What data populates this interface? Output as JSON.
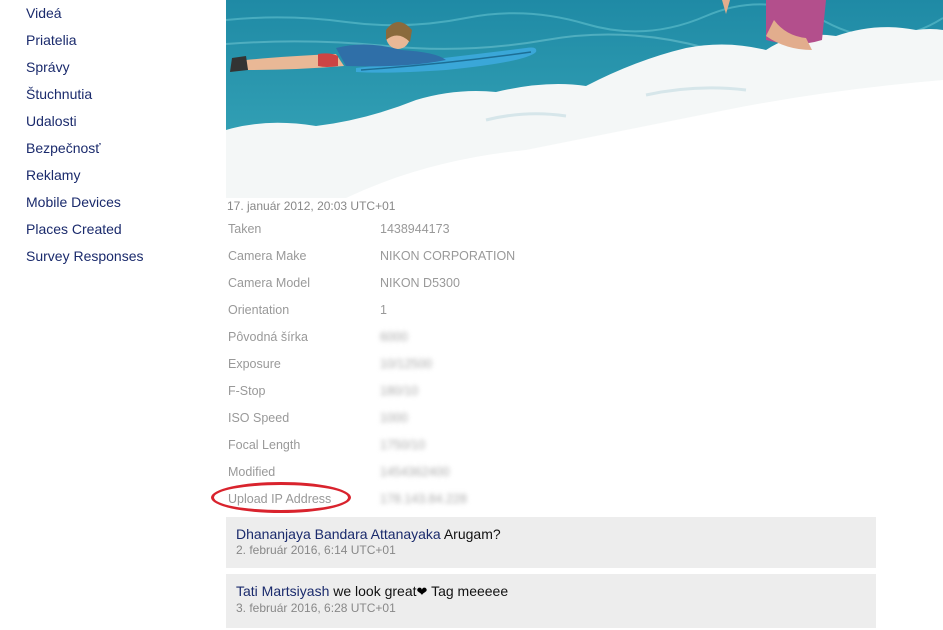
{
  "sidebar": {
    "items": [
      {
        "label": "Videá"
      },
      {
        "label": "Priatelia"
      },
      {
        "label": "Správy"
      },
      {
        "label": "Štuchnutia"
      },
      {
        "label": "Udalosti"
      },
      {
        "label": "Bezpečnosť"
      },
      {
        "label": "Reklamy"
      },
      {
        "label": "Mobile Devices"
      },
      {
        "label": "Places Created"
      },
      {
        "label": "Survey Responses"
      }
    ]
  },
  "photo": {
    "timestamp": "17. január 2012, 20:03 UTC+01"
  },
  "metadata": {
    "rows": [
      {
        "label": "Taken",
        "value": "1438944173"
      },
      {
        "label": "Camera Make",
        "value": "NIKON CORPORATION"
      },
      {
        "label": "Camera Model",
        "value": "NIKON D5300"
      },
      {
        "label": "Orientation",
        "value": "1"
      },
      {
        "label": "Pôvodná šírka",
        "value": "6000"
      },
      {
        "label": "Exposure",
        "value": "10/12500"
      },
      {
        "label": "F-Stop",
        "value": "180/10"
      },
      {
        "label": "ISO Speed",
        "value": "1000"
      },
      {
        "label": "Focal Length",
        "value": "1750/10"
      },
      {
        "label": "Modified",
        "value": "1454362400"
      },
      {
        "label": "Upload IP Address",
        "value": "178.143.84.228"
      }
    ]
  },
  "comments": [
    {
      "author": "Dhananjaya Bandara Attanayaka",
      "text": "Arugam?",
      "date": "2. február 2016, 6:14 UTC+01"
    },
    {
      "author": "Tati Martsiyash",
      "text_before": "we look great",
      "icon": "heart-icon",
      "text_after": "Tag meeeee",
      "date": "3. február 2016, 6:28 UTC+01"
    }
  ],
  "colors": {
    "link": "#1a2a6c",
    "muted": "#999999",
    "highlight": "#d9232d",
    "comment_bg": "#ededed"
  }
}
